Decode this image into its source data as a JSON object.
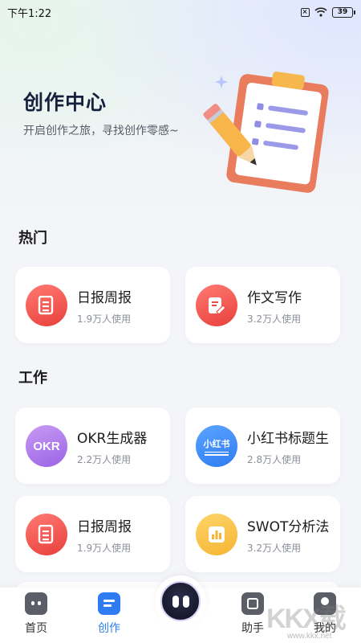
{
  "status_bar": {
    "time": "下午1:22",
    "battery": "39"
  },
  "hero": {
    "title": "创作中心",
    "subtitle": "开启创作之旅，寻找创作零感~"
  },
  "sections": {
    "hot": {
      "title": "热门",
      "cards": [
        {
          "name": "日报周报",
          "usage": "1.9万人使用",
          "icon": "document-icon",
          "color": "#ee4b43"
        },
        {
          "name": "作文写作",
          "usage": "3.2万人使用",
          "icon": "edit-document-icon",
          "color": "#ee4b43"
        }
      ]
    },
    "work": {
      "title": "工作",
      "cards": [
        {
          "name": "OKR生成器",
          "usage": "2.2万人使用",
          "icon": "okr-icon",
          "icon_text": "OKR",
          "color": "#a56fe8"
        },
        {
          "name": "小红书标题生",
          "usage": "2.8万人使用",
          "icon": "xiaohongshu-icon",
          "icon_text": "小红书",
          "color": "#3a86f5"
        },
        {
          "name": "日报周报",
          "usage": "1.9万人使用",
          "icon": "document-icon",
          "color": "#ee4b43"
        },
        {
          "name": "SWOT分析法",
          "usage": "3.2万人使用",
          "icon": "bar-chart-icon",
          "color": "#f5b532"
        }
      ]
    }
  },
  "tabbar": {
    "items": [
      {
        "label": "首页",
        "icon": "home-icon",
        "active": false
      },
      {
        "label": "创作",
        "icon": "create-icon",
        "active": true
      },
      {
        "label": "",
        "icon": "robot-icon",
        "active": false
      },
      {
        "label": "助手",
        "icon": "assistant-icon",
        "active": false
      },
      {
        "label": "我的",
        "icon": "profile-icon",
        "active": false
      }
    ]
  },
  "watermark": {
    "text": "KKX载",
    "url": "www.kkx.net"
  },
  "colors": {
    "accent": "#2f7cf2",
    "text_dark": "#15213d"
  }
}
